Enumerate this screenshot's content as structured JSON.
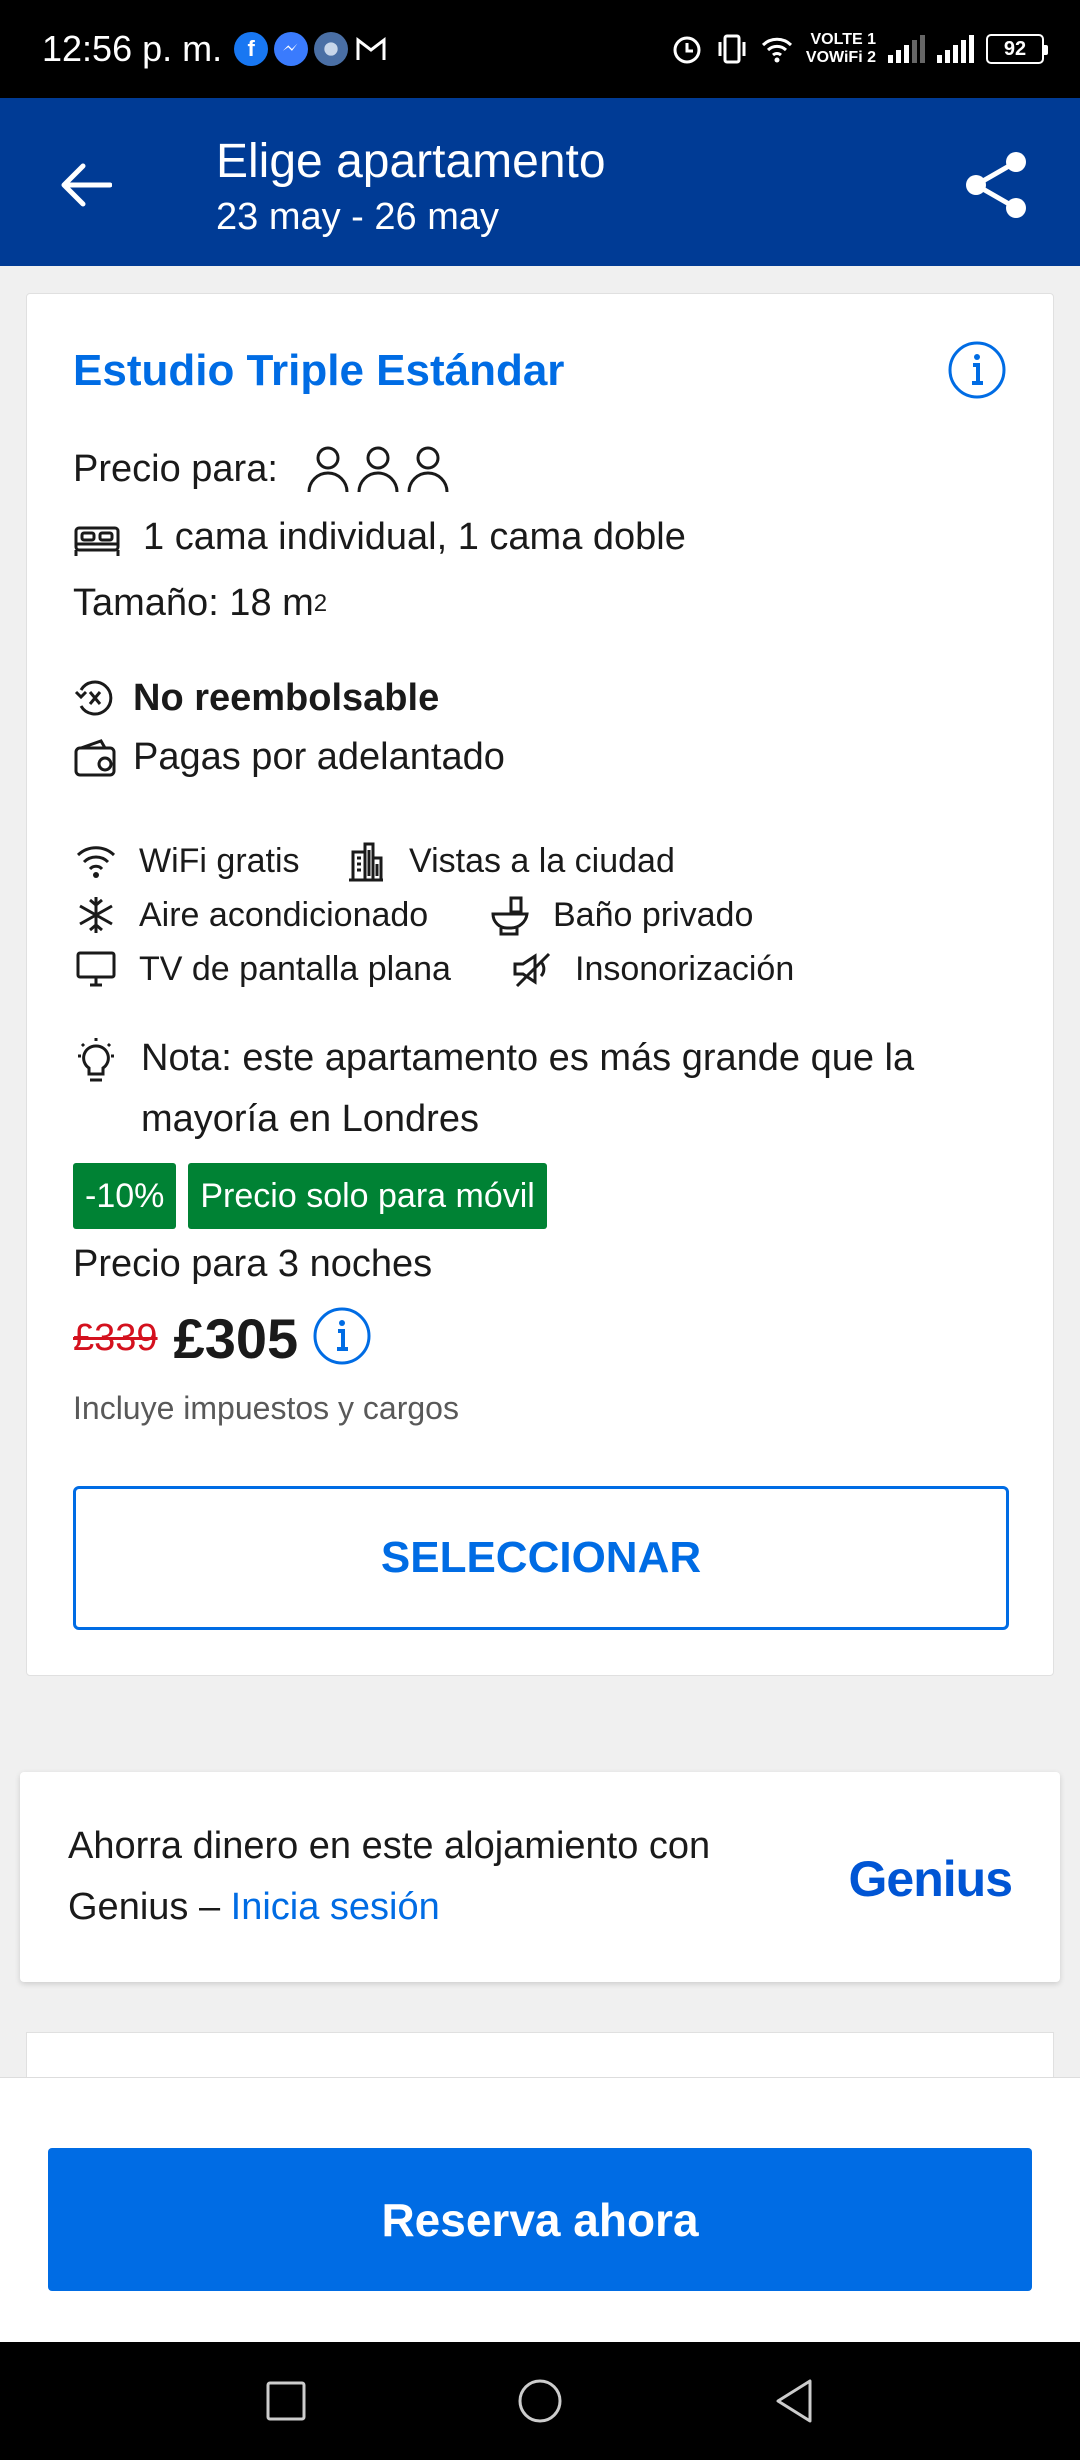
{
  "status_bar": {
    "time": "12:56 p. m.",
    "volte_line1": "VOLTE 1",
    "volte_line2": "VOWiFi 2",
    "battery": "92"
  },
  "header": {
    "title": "Elige apartamento",
    "dates": "23 may - 26 may"
  },
  "room": {
    "name": "Estudio Triple Estándar",
    "price_for_label": "Precio para:",
    "beds": "1 cama individual, 1 cama doble",
    "size_label": "Tamaño: 18 m",
    "size_sup": "2",
    "refund_policy": "No reembolsable",
    "payment": "Pagas por adelantado",
    "amenities": [
      "WiFi gratis",
      "Vistas a la ciudad",
      "Aire acondicionado",
      "Baño privado",
      "TV de pantalla plana",
      "Insonorización"
    ],
    "note": "Nota: este apartamento es más grande que la mayoría en Londres",
    "discount_badge": "-10%",
    "mobile_badge": "Precio solo para móvil",
    "price_label": "Precio para 3 noches",
    "old_price": "£339",
    "new_price": "£305",
    "taxes_note": "Incluye impuestos y cargos",
    "select_label": "SELECCIONAR"
  },
  "genius": {
    "text": "Ahorra dinero en este alojamiento con Genius – ",
    "link": "Inicia sesión",
    "logo": "Genius"
  },
  "footer": {
    "reserve_label": "Reserva ahora"
  },
  "colors": {
    "header_bg": "#003b95",
    "link_blue": "#006ce4",
    "badge_green": "#008234",
    "old_price_red": "#d4111e"
  }
}
